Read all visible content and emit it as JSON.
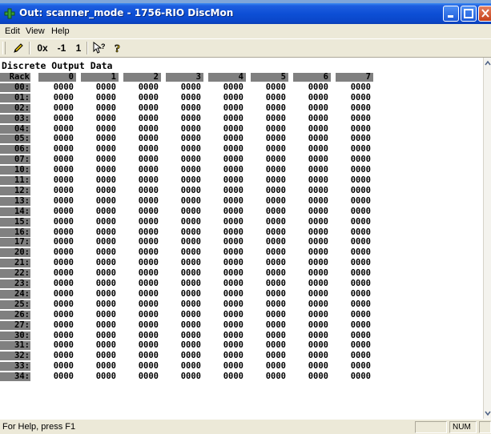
{
  "window": {
    "title": "Out: scanner_mode - 1756-RIO DiscMon"
  },
  "menu": {
    "items": [
      {
        "label": "Edit"
      },
      {
        "label": "View"
      },
      {
        "label": "Help"
      }
    ]
  },
  "toolbar": {
    "hex_label": "0x",
    "minus_one_label": "-1",
    "one_label": "1"
  },
  "content": {
    "heading": "Discrete Output Data",
    "rack_header": "Rack",
    "columns": [
      "0",
      "1",
      "2",
      "3",
      "4",
      "5",
      "6",
      "7"
    ],
    "rows": [
      {
        "label": "00:",
        "values": [
          "0000",
          "0000",
          "0000",
          "0000",
          "0000",
          "0000",
          "0000",
          "0000"
        ]
      },
      {
        "label": "01:",
        "values": [
          "0000",
          "0000",
          "0000",
          "0000",
          "0000",
          "0000",
          "0000",
          "0000"
        ]
      },
      {
        "label": "02:",
        "values": [
          "0000",
          "0000",
          "0000",
          "0000",
          "0000",
          "0000",
          "0000",
          "0000"
        ]
      },
      {
        "label": "03:",
        "values": [
          "0000",
          "0000",
          "0000",
          "0000",
          "0000",
          "0000",
          "0000",
          "0000"
        ]
      },
      {
        "label": "04:",
        "values": [
          "0000",
          "0000",
          "0000",
          "0000",
          "0000",
          "0000",
          "0000",
          "0000"
        ]
      },
      {
        "label": "05:",
        "values": [
          "0000",
          "0000",
          "0000",
          "0000",
          "0000",
          "0000",
          "0000",
          "0000"
        ]
      },
      {
        "label": "06:",
        "values": [
          "0000",
          "0000",
          "0000",
          "0000",
          "0000",
          "0000",
          "0000",
          "0000"
        ]
      },
      {
        "label": "07:",
        "values": [
          "0000",
          "0000",
          "0000",
          "0000",
          "0000",
          "0000",
          "0000",
          "0000"
        ]
      },
      {
        "label": "10:",
        "values": [
          "0000",
          "0000",
          "0000",
          "0000",
          "0000",
          "0000",
          "0000",
          "0000"
        ]
      },
      {
        "label": "11:",
        "values": [
          "0000",
          "0000",
          "0000",
          "0000",
          "0000",
          "0000",
          "0000",
          "0000"
        ]
      },
      {
        "label": "12:",
        "values": [
          "0000",
          "0000",
          "0000",
          "0000",
          "0000",
          "0000",
          "0000",
          "0000"
        ]
      },
      {
        "label": "13:",
        "values": [
          "0000",
          "0000",
          "0000",
          "0000",
          "0000",
          "0000",
          "0000",
          "0000"
        ]
      },
      {
        "label": "14:",
        "values": [
          "0000",
          "0000",
          "0000",
          "0000",
          "0000",
          "0000",
          "0000",
          "0000"
        ]
      },
      {
        "label": "15:",
        "values": [
          "0000",
          "0000",
          "0000",
          "0000",
          "0000",
          "0000",
          "0000",
          "0000"
        ]
      },
      {
        "label": "16:",
        "values": [
          "0000",
          "0000",
          "0000",
          "0000",
          "0000",
          "0000",
          "0000",
          "0000"
        ]
      },
      {
        "label": "17:",
        "values": [
          "0000",
          "0000",
          "0000",
          "0000",
          "0000",
          "0000",
          "0000",
          "0000"
        ]
      },
      {
        "label": "20:",
        "values": [
          "0000",
          "0000",
          "0000",
          "0000",
          "0000",
          "0000",
          "0000",
          "0000"
        ]
      },
      {
        "label": "21:",
        "values": [
          "0000",
          "0000",
          "0000",
          "0000",
          "0000",
          "0000",
          "0000",
          "0000"
        ]
      },
      {
        "label": "22:",
        "values": [
          "0000",
          "0000",
          "0000",
          "0000",
          "0000",
          "0000",
          "0000",
          "0000"
        ]
      },
      {
        "label": "23:",
        "values": [
          "0000",
          "0000",
          "0000",
          "0000",
          "0000",
          "0000",
          "0000",
          "0000"
        ]
      },
      {
        "label": "24:",
        "values": [
          "0000",
          "0000",
          "0000",
          "0000",
          "0000",
          "0000",
          "0000",
          "0000"
        ]
      },
      {
        "label": "25:",
        "values": [
          "0000",
          "0000",
          "0000",
          "0000",
          "0000",
          "0000",
          "0000",
          "0000"
        ]
      },
      {
        "label": "26:",
        "values": [
          "0000",
          "0000",
          "0000",
          "0000",
          "0000",
          "0000",
          "0000",
          "0000"
        ]
      },
      {
        "label": "27:",
        "values": [
          "0000",
          "0000",
          "0000",
          "0000",
          "0000",
          "0000",
          "0000",
          "0000"
        ]
      },
      {
        "label": "30:",
        "values": [
          "0000",
          "0000",
          "0000",
          "0000",
          "0000",
          "0000",
          "0000",
          "0000"
        ]
      },
      {
        "label": "31:",
        "values": [
          "0000",
          "0000",
          "0000",
          "0000",
          "0000",
          "0000",
          "0000",
          "0000"
        ]
      },
      {
        "label": "32:",
        "values": [
          "0000",
          "0000",
          "0000",
          "0000",
          "0000",
          "0000",
          "0000",
          "0000"
        ]
      },
      {
        "label": "33:",
        "values": [
          "0000",
          "0000",
          "0000",
          "0000",
          "0000",
          "0000",
          "0000",
          "0000"
        ]
      },
      {
        "label": "34:",
        "values": [
          "0000",
          "0000",
          "0000",
          "0000",
          "0000",
          "0000",
          "0000",
          "0000"
        ]
      }
    ]
  },
  "status": {
    "help_text": "For Help, press F1",
    "num_indicator": "NUM"
  },
  "colors": {
    "titlebar": "#0a46c9",
    "header_cell": "#808080",
    "chrome": "#ece9d8"
  }
}
